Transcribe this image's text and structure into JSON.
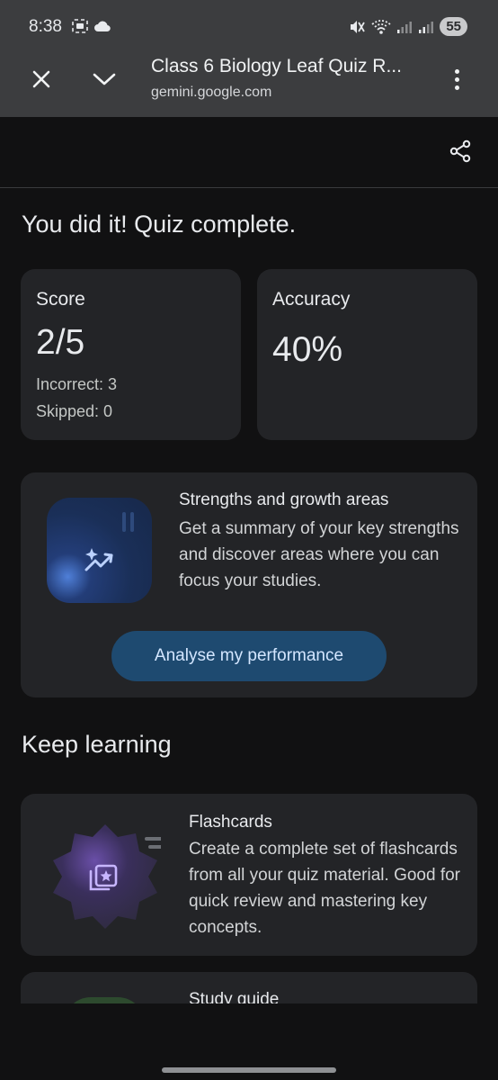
{
  "status_bar": {
    "time": "8:38",
    "battery": "55"
  },
  "browser": {
    "title": "Class 6 Biology Leaf Quiz R...",
    "url": "gemini.google.com"
  },
  "quiz": {
    "heading": "You did it! Quiz complete.",
    "score": {
      "label": "Score",
      "value": "2/5",
      "incorrect": "Incorrect: 3",
      "skipped": "Skipped: 0"
    },
    "accuracy": {
      "label": "Accuracy",
      "value": "40%"
    }
  },
  "strengths": {
    "title": "Strengths and growth areas",
    "description": "Get a summary of your key strengths and discover areas where you can focus your studies.",
    "button": "Analyse my performance"
  },
  "keep_learning": {
    "heading": "Keep learning",
    "flashcards": {
      "title": "Flashcards",
      "description": "Create a complete set of flashcards from all your quiz material. Good for quick review and mastering key concepts."
    },
    "study_guide": {
      "title": "Study guide"
    }
  },
  "icons": {
    "close": "close-icon",
    "collapse": "chevron-down-icon",
    "menu": "more-vert-icon",
    "share": "share-icon",
    "strengths": "trending-sparkle-icon",
    "flashcards": "flashcards-icon"
  },
  "colors": {
    "background": "#111112",
    "header": "#3c3d3f",
    "card": "#232427",
    "button": "#1e4a70",
    "button_text": "#d3e6ff"
  }
}
